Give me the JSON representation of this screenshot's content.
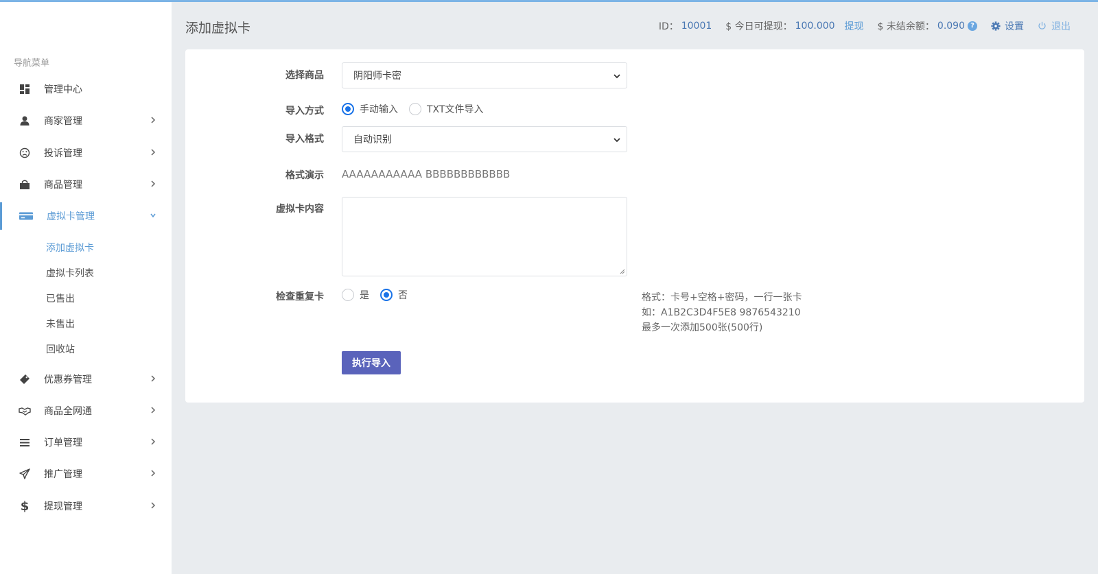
{
  "header": {
    "page_title": "添加虚拟卡",
    "id_label": "ID：",
    "id_value": "10001",
    "withdraw_label": "$ 今日可提现：",
    "withdraw_value": "100.000",
    "withdraw_link": "提现",
    "unsettled_label": "$ 未结余额：",
    "unsettled_value": "0.090",
    "help_mark": "?",
    "settings_label": "设置",
    "logout_label": "退出"
  },
  "sidebar": {
    "heading": "导航菜单",
    "items": [
      {
        "label": "管理中心",
        "icon": "dashboard-icon"
      },
      {
        "label": "商家管理",
        "icon": "user-icon"
      },
      {
        "label": "投诉管理",
        "icon": "frown-icon"
      },
      {
        "label": "商品管理",
        "icon": "shopping-bag-icon"
      },
      {
        "label": "虚拟卡管理",
        "icon": "credit-card-icon"
      },
      {
        "label": "优惠券管理",
        "icon": "tag-icon"
      },
      {
        "label": "商品全网通",
        "icon": "handshake-icon"
      },
      {
        "label": "订单管理",
        "icon": "list-icon"
      },
      {
        "label": "推广管理",
        "icon": "paper-plane-icon"
      },
      {
        "label": "提现管理",
        "icon": "dollar-icon"
      }
    ],
    "subitems": [
      "添加虚拟卡",
      "虚拟卡列表",
      "已售出",
      "未售出",
      "回收站"
    ]
  },
  "form": {
    "product_label": "选择商品",
    "product_value": "阴阳师卡密",
    "import_mode_label": "导入方式",
    "import_mode_options": [
      "手动输入",
      "TXT文件导入"
    ],
    "import_format_label": "导入格式",
    "import_format_value": "自动识别",
    "format_demo_label": "格式演示",
    "format_demo_value": "AAAAAAAAAAA BBBBBBBBBBBB",
    "content_label": "虚拟卡内容",
    "content_value": "",
    "dup_check_label": "检查重复卡",
    "dup_check_options": [
      "是",
      "否"
    ],
    "hint_lines": [
      "格式：卡号+空格+密码，一行一张卡",
      "如：A1B2C3D4F5E8 9876543210",
      "最多一次添加500张(500行)"
    ],
    "submit_label": "执行导入"
  },
  "colors": {
    "accent": "#5b9bd5",
    "button": "#5a63bb",
    "radio_checked": "#1a73e8"
  }
}
